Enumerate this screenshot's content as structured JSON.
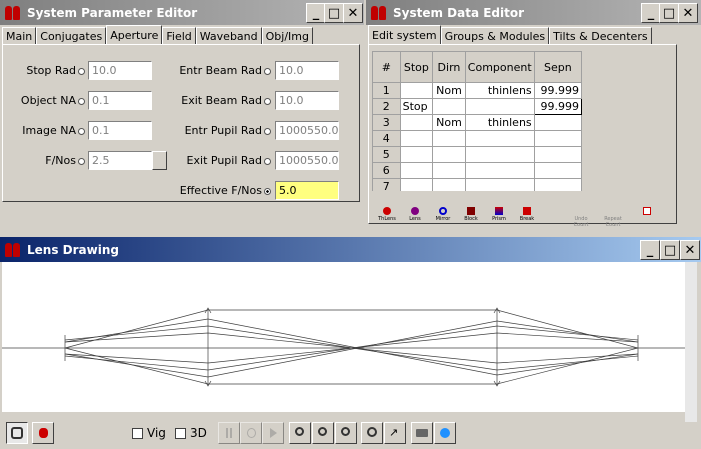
{
  "param_editor": {
    "title": "System Parameter Editor",
    "tabs": [
      "Main",
      "Conjugates",
      "Aperture",
      "Field",
      "Waveband",
      "Obj/Img"
    ],
    "left_fields": [
      {
        "label": "Stop Rad",
        "value": "10.0"
      },
      {
        "label": "Object NA",
        "value": "0.1"
      },
      {
        "label": "Image NA",
        "value": "0.1"
      },
      {
        "label": "F/Nos",
        "value": "2.5"
      }
    ],
    "right_fields": [
      {
        "label": "Entr Beam Rad",
        "value": "10.0"
      },
      {
        "label": "Exit Beam Rad",
        "value": "10.0"
      },
      {
        "label": "Entr Pupil Rad",
        "value": "1000550.0"
      },
      {
        "label": "Exit Pupil Rad",
        "value": "1000550.0"
      },
      {
        "label": "Effective F/Nos",
        "value": "5.0"
      }
    ]
  },
  "data_editor": {
    "title": "System Data Editor",
    "tabs": [
      "Edit system",
      "Groups & Modules",
      "Tilts & Decenters"
    ],
    "columns": [
      "#",
      "Stop",
      "Dirn",
      "Component",
      "Sepn"
    ],
    "rows": [
      {
        "n": "1",
        "stop": "",
        "dirn": "Nom",
        "component": "thinlens",
        "sepn": "99.999"
      },
      {
        "n": "2",
        "stop": "Stop",
        "dirn": "",
        "component": "",
        "sepn": "99.999"
      },
      {
        "n": "3",
        "stop": "",
        "dirn": "Nom",
        "component": "thinlens",
        "sepn": ""
      },
      {
        "n": "4",
        "stop": "",
        "dirn": "",
        "component": "",
        "sepn": ""
      },
      {
        "n": "5",
        "stop": "",
        "dirn": "",
        "component": "",
        "sepn": ""
      },
      {
        "n": "6",
        "stop": "",
        "dirn": "",
        "component": "",
        "sepn": ""
      },
      {
        "n": "7",
        "stop": "",
        "dirn": "",
        "component": "",
        "sepn": ""
      }
    ],
    "tools": [
      "ThLens",
      "Lens",
      "Mirror",
      "Block",
      "Prism",
      "Break",
      "Undo Count",
      "Repeat Count",
      ""
    ]
  },
  "lens_drawing": {
    "title": "Lens Drawing",
    "vig_label": "Vig",
    "threed_label": "3D"
  },
  "colors": {
    "active_title": "#0a246a",
    "inactive_title": "#808080",
    "highlight_field": "#ffff80"
  }
}
